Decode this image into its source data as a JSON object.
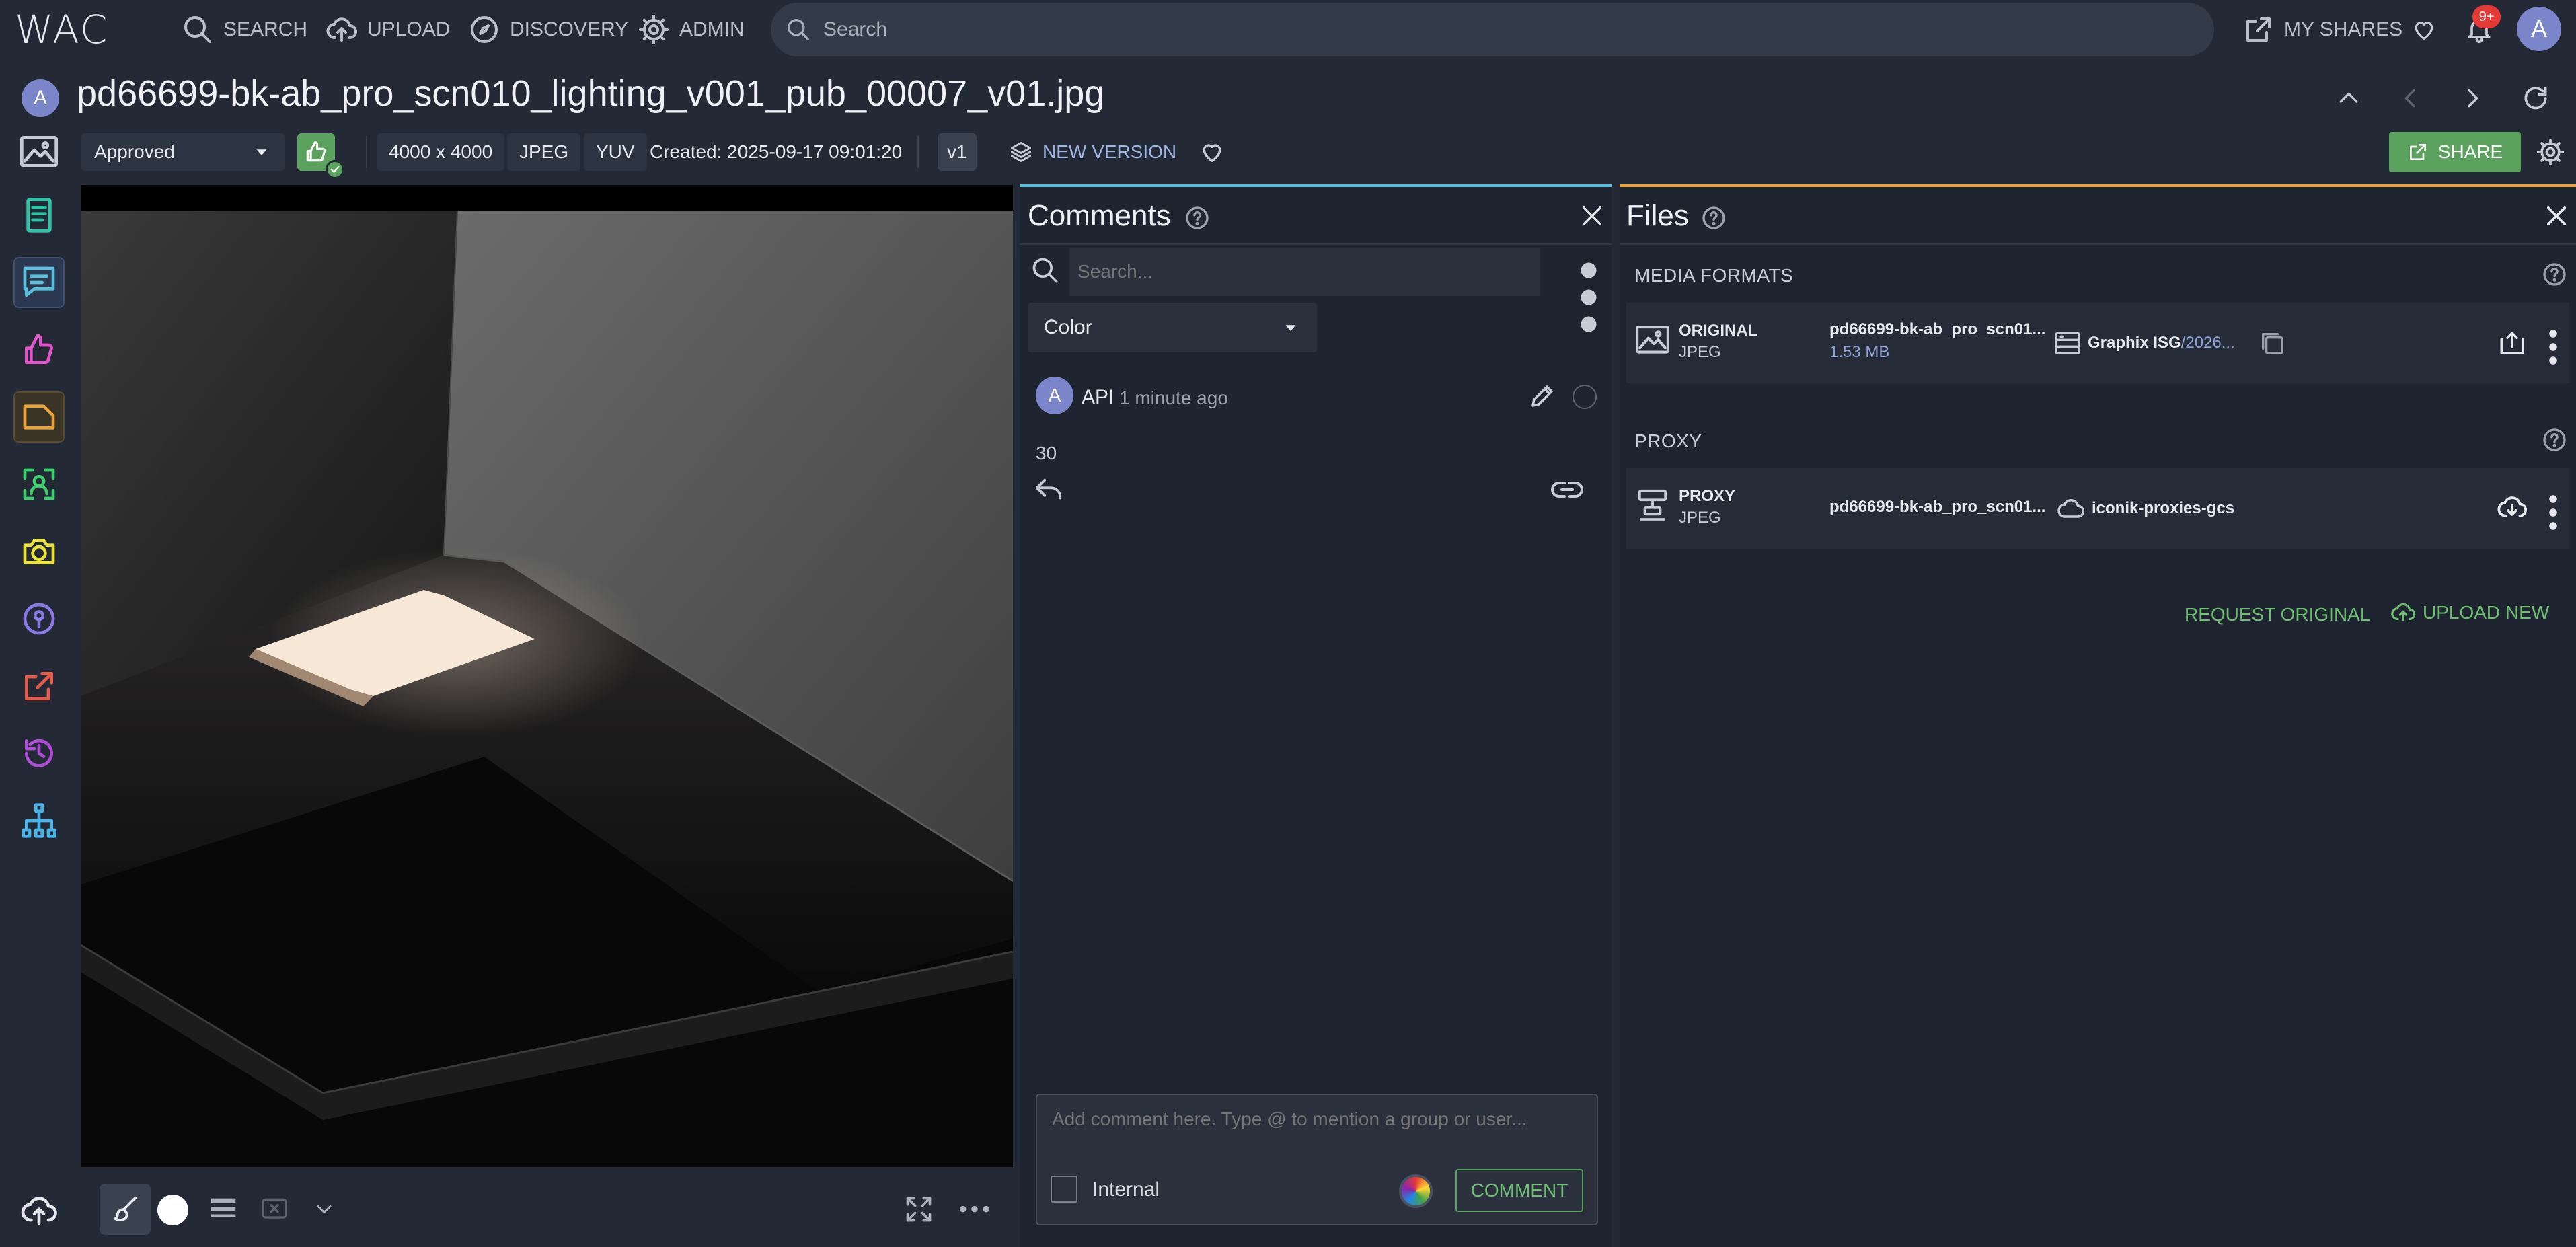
{
  "nav": {
    "logo": "WAC",
    "items": [
      {
        "label": "SEARCH",
        "icon": "search-icon"
      },
      {
        "label": "UPLOAD",
        "icon": "cloud-upload-icon"
      },
      {
        "label": "DISCOVERY",
        "icon": "compass-icon"
      },
      {
        "label": "ADMIN",
        "icon": "gear-icon"
      }
    ],
    "search_placeholder": "Search",
    "my_shares": "MY SHARES",
    "notification_badge": "9+",
    "user_initial": "A"
  },
  "asset": {
    "owner_initial": "A",
    "title": "pd66699-bk-ab_pro_scn010_lighting_v001_pub_00007_v01.jpg",
    "status": "Approved",
    "dimensions": "4000 x 4000",
    "format": "JPEG",
    "color_space": "YUV",
    "created": "Created: 2025-09-17 09:01:20",
    "version": "v1",
    "new_version_label": "NEW VERSION",
    "share_label": "SHARE"
  },
  "comments": {
    "title": "Comments",
    "search_placeholder": "Search...",
    "filter_value": "Color",
    "items": [
      {
        "author_initial": "A",
        "author": "API",
        "time": "1 minute ago",
        "body": "30"
      }
    ],
    "input_placeholder": "Add comment here. Type @ to mention a group or user...",
    "internal_label": "Internal",
    "submit_label": "COMMENT"
  },
  "files": {
    "title": "Files",
    "media_formats_label": "MEDIA FORMATS",
    "original": {
      "type": "ORIGINAL",
      "format": "JPEG",
      "filename": "pd66699-bk-ab_pro_scn01...",
      "size": "1.53 MB",
      "storage": "Graphix ISG",
      "storage_path": "/2026..."
    },
    "proxy_label": "PROXY",
    "proxy": {
      "type": "PROXY",
      "format": "JPEG",
      "filename": "pd66699-bk-ab_pro_scn01...",
      "storage": "iconik-proxies-gcs"
    },
    "request_original": "REQUEST ORIGINAL",
    "upload_new": "UPLOAD NEW"
  },
  "colors": {
    "accent_green": "#5aa25d",
    "comments_accent": "#5bc0de",
    "files_accent": "#e8a33a",
    "badge_red": "#e53935"
  }
}
